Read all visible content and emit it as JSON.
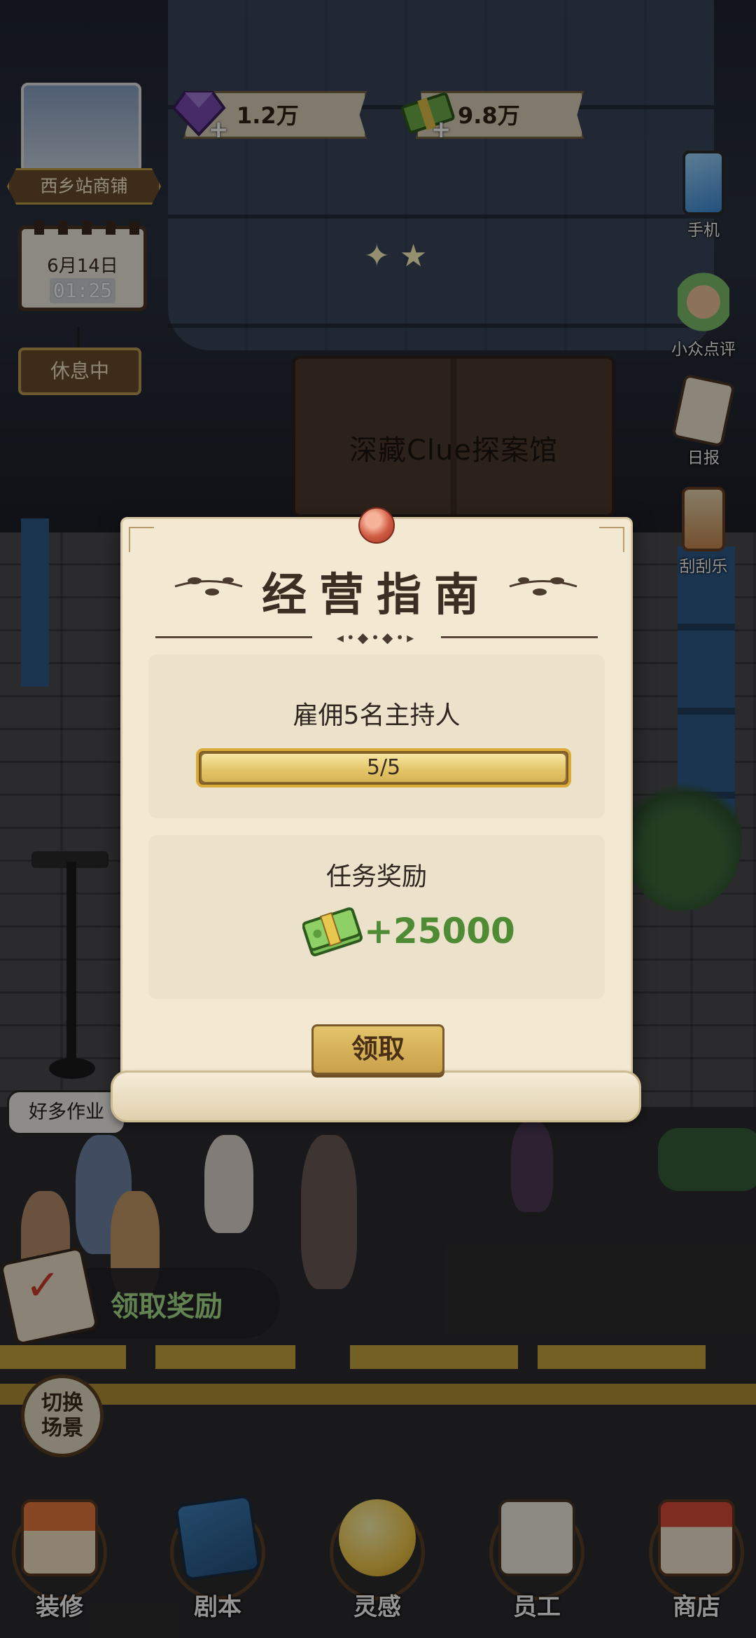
{
  "hud": {
    "shop_name": "西乡站商铺",
    "date": "6月14日",
    "time": "01:25",
    "status": "休息中",
    "gems": "1.2万",
    "cash": "9.8万",
    "plus": "+"
  },
  "side_menu": [
    {
      "label": "手机",
      "icon": "phone-icon"
    },
    {
      "label": "小众点评",
      "icon": "thumbs-up-icon"
    },
    {
      "label": "日报",
      "icon": "clipboard-icon"
    },
    {
      "label": "刮刮乐",
      "icon": "lottery-ticket-icon"
    }
  ],
  "scene": {
    "store_sign": "深藏Clue探案馆",
    "speech_bubble": "好多作业",
    "claim_rewards_label": "领取奖励",
    "switch_scene_line1": "切换",
    "switch_scene_line2": "场景"
  },
  "modal": {
    "title": "经营指南",
    "task": "雇佣5名主持人",
    "progress_text": "5/5",
    "progress": 1.0,
    "reward_title": "任务奖励",
    "reward_amount": "+25000",
    "claim_button": "领取"
  },
  "bottom_nav": [
    {
      "label": "装修",
      "icon": "house-icon"
    },
    {
      "label": "剧本",
      "icon": "script-book-icon"
    },
    {
      "label": "灵感",
      "icon": "lightbulb-icon"
    },
    {
      "label": "员工",
      "icon": "staff-badge-icon"
    },
    {
      "label": "商店",
      "icon": "shop-icon"
    }
  ],
  "colors": {
    "accent_gold": "#d9a93a",
    "reward_green": "#4f8b35",
    "modal_bg": "#f3e8d2"
  }
}
